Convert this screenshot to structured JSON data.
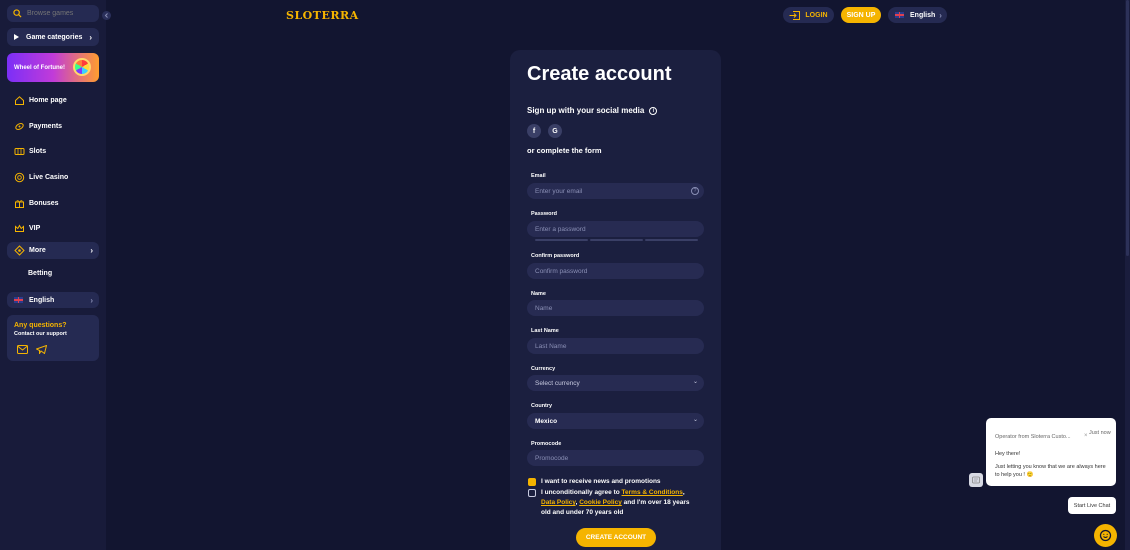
{
  "sidebar": {
    "search_placeholder": "Browse games",
    "game_categories": "Game categories",
    "promo_label": "Wheel of Fortune!",
    "nav": [
      {
        "label": "Home page",
        "icon": "home-icon"
      },
      {
        "label": "Payments",
        "icon": "payments-icon"
      },
      {
        "label": "Slots",
        "icon": "slots-icon"
      },
      {
        "label": "Live Casino",
        "icon": "live-casino-icon"
      },
      {
        "label": "Bonuses",
        "icon": "gift-icon"
      },
      {
        "label": "VIP",
        "icon": "crown-icon"
      }
    ],
    "more": "More",
    "betting": "Betting",
    "language": "English",
    "support_title": "Any questions?",
    "support_sub": "Contact our support"
  },
  "header": {
    "logo": "SLOTERRA",
    "login": "LOGIN",
    "signup": "SIGN UP",
    "language": "English"
  },
  "form": {
    "title": "Create account",
    "social_label": "Sign up with your social media",
    "social": [
      {
        "label": "f",
        "name": "facebook"
      },
      {
        "label": "G",
        "name": "google"
      }
    ],
    "or_label": "or complete the form",
    "email_label": "Email",
    "email_placeholder": "Enter your email",
    "password_label": "Password",
    "password_placeholder": "Enter a password",
    "confirm_label": "Confirm password",
    "confirm_placeholder": "Confirm password",
    "name_label": "Name",
    "name_placeholder": "Name",
    "lastname_label": "Last Name",
    "lastname_placeholder": "Last Name",
    "currency_label": "Currency",
    "currency_value": "Select currency",
    "country_label": "Country",
    "country_value": "Mexico",
    "promocode_label": "Promocode",
    "promocode_placeholder": "Promocode",
    "news_checkbox": "I want to receive news and promotions",
    "agree_prefix": "I unconditionally agree to",
    "terms_link": "Terms & Conditions",
    "data_policy_link": "Data Policy",
    "cookie_policy_link": "Cookie Policy",
    "agree_suffix": "and I'm over 18 years old and under 70 years old",
    "submit": "CREATE ACCOUNT"
  },
  "chat": {
    "from": "Operator from Sloterra Custo...",
    "time": "Just now",
    "greeting": "Hey there!",
    "message": "Just letting you know that we are always here to help you ! 🙂",
    "start_label": "Start Live Chat"
  },
  "colors": {
    "accent": "#f5b400",
    "background": "#121530",
    "sidebar": "#181b3a",
    "panel": "#1b1f3f",
    "field": "#272b52"
  }
}
